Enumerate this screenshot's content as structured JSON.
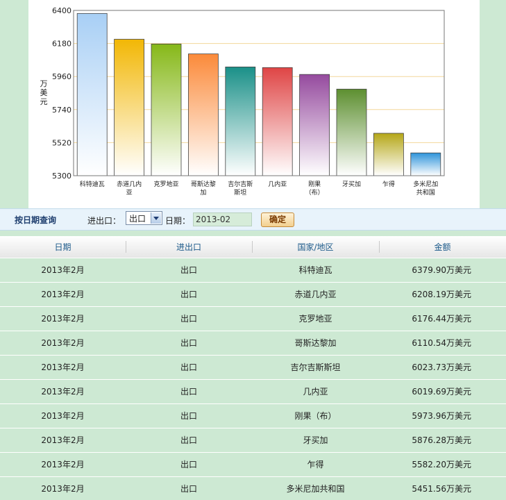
{
  "chart_data": {
    "type": "bar",
    "categories": [
      "科特迪瓦",
      "赤道几内亚",
      "克罗地亚",
      "哥斯达黎加",
      "吉尔吉斯斯坦",
      "几内亚",
      "刚果（布）",
      "牙买加",
      "乍得",
      "多米尼加共和国"
    ],
    "category_tick_labels": [
      [
        "科特迪瓦"
      ],
      [
        "赤道几内",
        "亚"
      ],
      [
        "克罗地亚"
      ],
      [
        "哥斯达黎",
        "加"
      ],
      [
        "吉尔吉斯",
        "斯坦"
      ],
      [
        "几内亚"
      ],
      [
        "刚果",
        "（布）"
      ],
      [
        "牙买加"
      ],
      [
        "乍得"
      ],
      [
        "多米尼加",
        "共和国"
      ]
    ],
    "values": [
      6379.9,
      6208.19,
      6176.44,
      6110.54,
      6023.73,
      6019.69,
      5973.96,
      5876.28,
      5582.2,
      5451.56
    ],
    "colors": [
      "#a8cff5",
      "#f2b705",
      "#86b818",
      "#fb8a3a",
      "#1a9088",
      "#df4545",
      "#954a9e",
      "#5d8f30",
      "#b5a718",
      "#2e94da"
    ],
    "ylabel": "万美元",
    "ylim": [
      5300,
      6400
    ],
    "yticks": [
      "6400",
      "6180",
      "5960",
      "5740",
      "5520",
      "5300"
    ],
    "grid": true
  },
  "query": {
    "title": "按日期查询",
    "direction_label": "进出口：",
    "direction_value": "出口",
    "date_label": "日期：",
    "date_value": "2013-02",
    "confirm_label": "确定"
  },
  "table": {
    "headers": [
      "日期",
      "进出口",
      "国家/地区",
      "金额"
    ],
    "rows": [
      [
        "2013年2月",
        "出口",
        "科特迪瓦",
        "6379.90万美元"
      ],
      [
        "2013年2月",
        "出口",
        "赤道几内亚",
        "6208.19万美元"
      ],
      [
        "2013年2月",
        "出口",
        "克罗地亚",
        "6176.44万美元"
      ],
      [
        "2013年2月",
        "出口",
        "哥斯达黎加",
        "6110.54万美元"
      ],
      [
        "2013年2月",
        "出口",
        "吉尔吉斯斯坦",
        "6023.73万美元"
      ],
      [
        "2013年2月",
        "出口",
        "几内亚",
        "6019.69万美元"
      ],
      [
        "2013年2月",
        "出口",
        "刚果（布）",
        "5973.96万美元"
      ],
      [
        "2013年2月",
        "出口",
        "牙买加",
        "5876.28万美元"
      ],
      [
        "2013年2月",
        "出口",
        "乍得",
        "5582.20万美元"
      ],
      [
        "2013年2月",
        "出口",
        "多米尼加共和国",
        "5451.56万美元"
      ]
    ]
  }
}
